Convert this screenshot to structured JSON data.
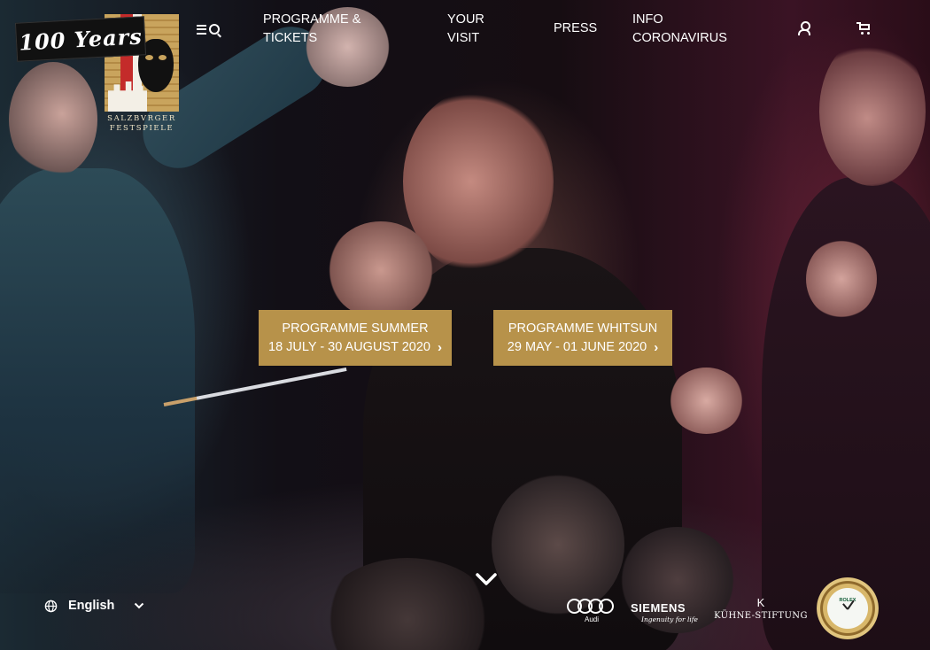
{
  "brand": {
    "anniversary_badge": "100 Years",
    "logo_text_line1": "SALZBVRGER",
    "logo_text_line2": "FESTSPIELE"
  },
  "header": {
    "menu_icon": "menu-search-icon",
    "nav": [
      {
        "line1": "PROGRAMME &",
        "line2": "TICKETS"
      },
      {
        "line1": "YOUR",
        "line2": "VISIT"
      },
      {
        "line1": "PRESS",
        "line2": ""
      },
      {
        "line1": "INFO",
        "line2": "CORONAVIRUS"
      }
    ],
    "account_icon": "user-icon",
    "cart_icon": "cart-icon"
  },
  "hero": {
    "cta": [
      {
        "title": "PROGRAMME SUMMER",
        "dates": "18 JULY - 30 AUGUST 2020",
        "icon": "chevron-right-icon"
      },
      {
        "title": "PROGRAMME WHITSUN",
        "dates": "29 MAY - 01 JUNE 2020",
        "icon": "chevron-right-icon"
      }
    ],
    "scroll_icon": "chevron-down-icon"
  },
  "footer": {
    "language": {
      "icon": "globe-icon",
      "value": "English",
      "caret_icon": "chevron-down-icon"
    },
    "sponsors": {
      "audi": "Audi",
      "siemens": "SIEMENS",
      "siemens_tagline": "Ingenuity for life",
      "kuehne_mark": "K",
      "kuehne": "KÜHNE-STIFTUNG",
      "rolex": "ROLEX"
    }
  },
  "colors": {
    "accent_gold": "#b7924a",
    "text": "#ffffff"
  }
}
